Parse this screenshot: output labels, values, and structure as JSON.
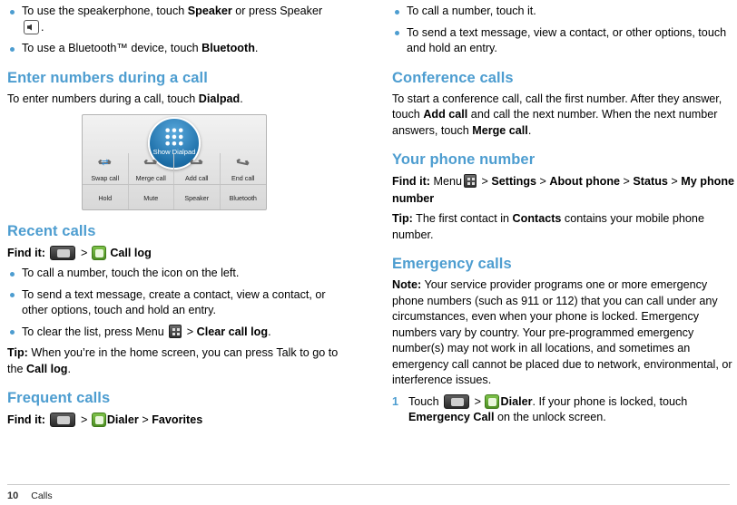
{
  "left": {
    "top_bullets": [
      {
        "pre": "To use the speakerphone, touch ",
        "b1": "Speaker",
        "mid": " or press Speaker ",
        "icon": "speaker-icon",
        "post": "."
      },
      {
        "pre": "To use a Bluetooth™ device, touch ",
        "b1": "Bluetooth",
        "mid": "",
        "post": "."
      }
    ],
    "s1_title": "Enter numbers during a call",
    "s1_p_pre": "To enter numbers during a call, touch ",
    "s1_p_bold": "Dialpad",
    "s1_p_post": ".",
    "figure": {
      "dialpad_label": "Show Dialpad",
      "row1": [
        "Swap call",
        "Merge call",
        "Add call",
        "End call"
      ],
      "row2": [
        "Hold",
        "Mute",
        "Speaker",
        "Bluetooth"
      ]
    },
    "s2_title": "Recent calls",
    "s2_findit_label": "Find it:",
    "s2_findit_sep": ">",
    "s2_findit_target": "Call log",
    "s2_bullets": [
      {
        "pre": "To call a number, touch the icon on the left.",
        "b1": "",
        "post": ""
      },
      {
        "pre": "To send a text message, create a contact, view a contact, or other options, touch and hold an entry.",
        "b1": "",
        "post": ""
      },
      {
        "pre": "To clear the list, press Menu ",
        "b1": "Clear call log",
        "mid": " > ",
        "post": "."
      }
    ],
    "s2_tip_label": "Tip:",
    "s2_tip_pre": " When you’re in the home screen, you can press Talk to go to the ",
    "s2_tip_bold": "Call log",
    "s2_tip_post": ".",
    "s3_title": "Frequent calls",
    "s3_findit_label": "Find it:",
    "s3_findit_sep1": ">",
    "s3_findit_b1": "Dialer",
    "s3_findit_sep2": ">",
    "s3_findit_b2": "Favorites"
  },
  "right": {
    "top_bullets": [
      {
        "pre": "To call a number, touch it.",
        "b1": "",
        "post": ""
      },
      {
        "pre": "To send a text message, view a contact, or other options, touch and hold an entry.",
        "b1": "",
        "post": ""
      }
    ],
    "s1_title": "Conference calls",
    "s1_p_a": "To start a conference call, call the first number. After they answer, touch ",
    "s1_p_b1": "Add call",
    "s1_p_b": " and call the next number. When the next number answers, touch ",
    "s1_p_b2": "Merge call",
    "s1_p_c": ".",
    "s2_title": "Your phone number",
    "s2_findit_label": "Find it:",
    "s2_findit_menu": "Menu",
    "s2_findit_sep1": ">",
    "s2_findit_b1": "Settings",
    "s2_findit_sep2": ">",
    "s2_findit_b2": "About phone",
    "s2_findit_sep3": ">",
    "s2_findit_b3": "Status",
    "s2_findit_sep4": ">",
    "s2_findit_b4": "My phone number",
    "s2_tip_label": "Tip:",
    "s2_tip_a": " The first contact in ",
    "s2_tip_b1": "Contacts",
    "s2_tip_b": " contains your mobile phone number.",
    "s3_title": "Emergency calls",
    "s3_note_label": "Note:",
    "s3_note_body": " Your service provider programs one or more emergency phone numbers (such as 911 or 112) that you can call under any circumstances, even when your phone is locked. Emergency numbers vary by country. Your pre-programmed emergency number(s) may not work in all locations, and sometimes an emergency call cannot be placed due to network, environmental, or interference issues.",
    "s3_step_num": "1",
    "s3_step_a": "Touch ",
    "s3_step_sep": ">",
    "s3_step_b1": "Dialer",
    "s3_step_b": ". If your phone is locked, touch ",
    "s3_step_b2": "Emergency Call",
    "s3_step_c": " on the unlock screen."
  },
  "footer": {
    "page_number": "10",
    "caption": "Calls"
  },
  "colors": {
    "heading": "#4d9dd0",
    "bullet": "#4d9dd0",
    "body": "#000000",
    "rule": "#c9c9c9"
  }
}
